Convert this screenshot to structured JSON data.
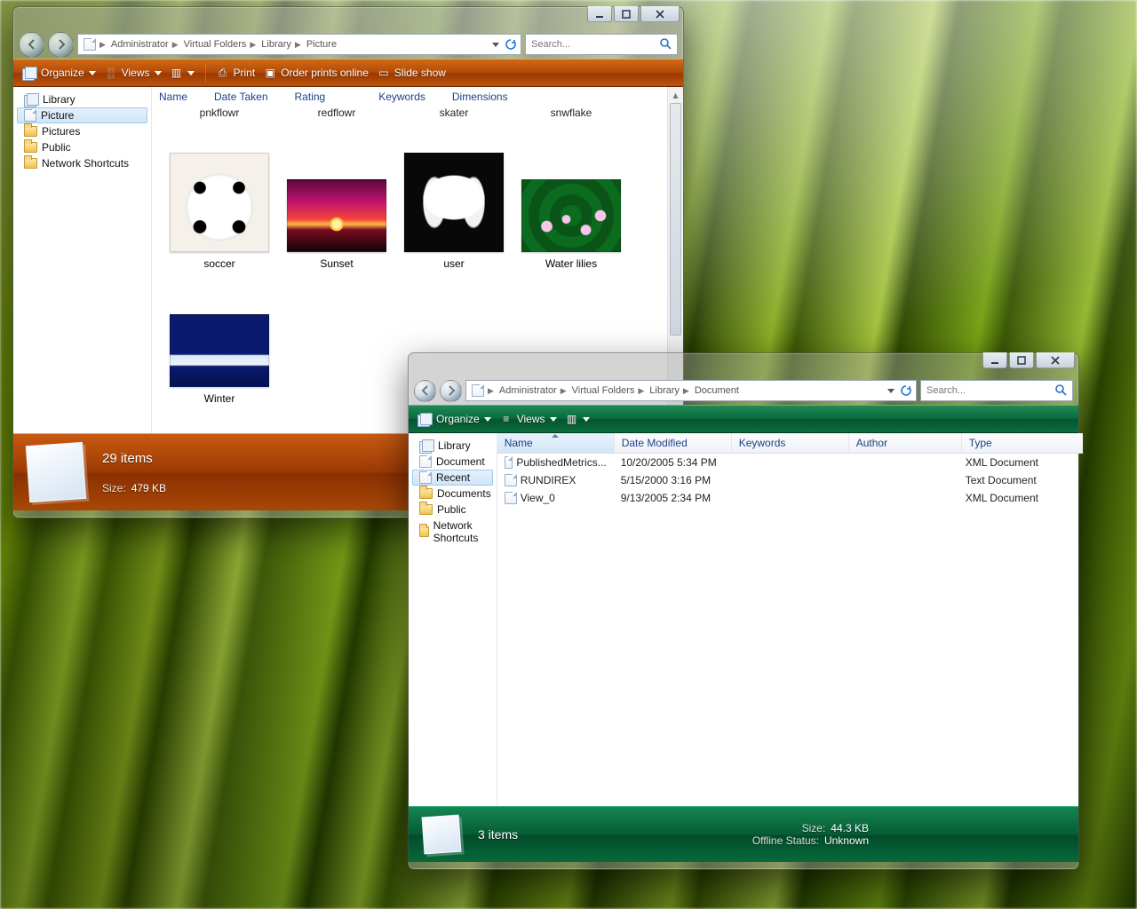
{
  "win1": {
    "breadcrumbs": [
      "Administrator",
      "Virtual Folders",
      "Library",
      "Picture"
    ],
    "search_placeholder": "Search...",
    "toolbar": {
      "organize": "Organize",
      "views": "Views",
      "print": "Print",
      "order": "Order prints online",
      "slide": "Slide show"
    },
    "columns": [
      "Name",
      "Date Taken",
      "Rating",
      "Keywords",
      "Dimensions"
    ],
    "tree": [
      {
        "label": "Library",
        "icon": "stack"
      },
      {
        "label": "Picture",
        "icon": "page",
        "sel": true
      },
      {
        "label": "Pictures",
        "icon": "folder"
      },
      {
        "label": "Public",
        "icon": "folder"
      },
      {
        "label": "Network Shortcuts",
        "icon": "folder"
      }
    ],
    "row1_labels": [
      "pnkflowr",
      "redflowr",
      "skater",
      "snwflake"
    ],
    "row2": [
      {
        "label": "soccer",
        "art": "soccer"
      },
      {
        "label": "Sunset",
        "art": "sunset"
      },
      {
        "label": "user",
        "art": "flower"
      },
      {
        "label": "Water lilies",
        "art": "lilies"
      }
    ],
    "row3": [
      {
        "label": "Winter",
        "art": "winter"
      }
    ],
    "status": {
      "count": "29 items",
      "size_k": "Size:",
      "size_v": "479 KB"
    }
  },
  "win2": {
    "breadcrumbs": [
      "Administrator",
      "Virtual Folders",
      "Library",
      "Document"
    ],
    "search_placeholder": "Search...",
    "toolbar": {
      "organize": "Organize",
      "views": "Views"
    },
    "columns": {
      "name": "Name",
      "date": "Date Modified",
      "key": "Keywords",
      "auth": "Author",
      "type": "Type"
    },
    "tree": [
      {
        "label": "Library",
        "icon": "stack"
      },
      {
        "label": "Document",
        "icon": "page"
      },
      {
        "label": "Recent",
        "icon": "page",
        "sel": true
      },
      {
        "label": "Documents",
        "icon": "folder"
      },
      {
        "label": "Public",
        "icon": "folder"
      },
      {
        "label": "Network Shortcuts",
        "icon": "folder"
      }
    ],
    "rows": [
      {
        "name": "PublishedMetrics...",
        "date": "10/20/2005 5:34 PM",
        "type": "XML Document"
      },
      {
        "name": "RUNDIREX",
        "date": "5/15/2000 3:16 PM",
        "type": "Text Document"
      },
      {
        "name": "View_0",
        "date": "9/13/2005 2:34 PM",
        "type": "XML Document"
      }
    ],
    "status": {
      "count": "3 items",
      "size_k": "Size:",
      "size_v": "44.3 KB",
      "off_k": "Offline Status:",
      "off_v": "Unknown"
    }
  }
}
